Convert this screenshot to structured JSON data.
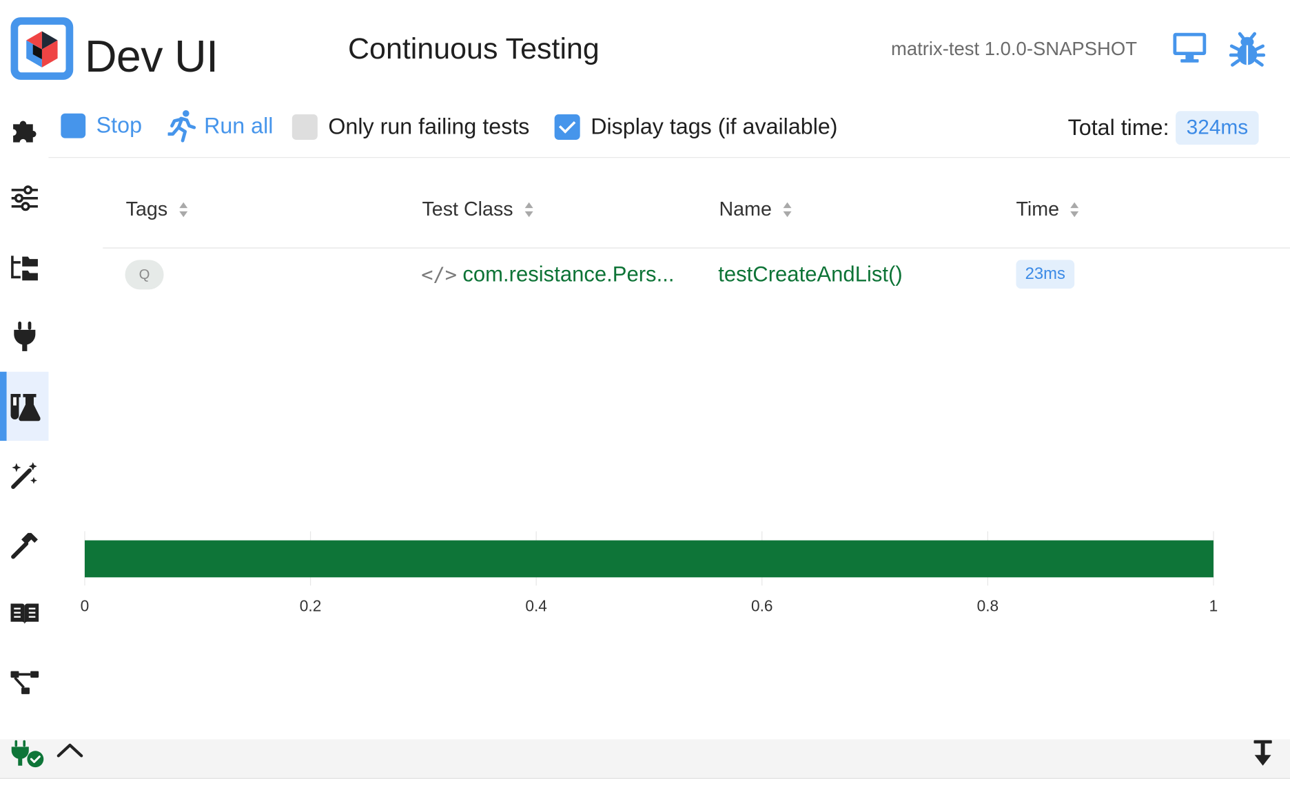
{
  "header": {
    "logo_text": "Dev UI",
    "page_title": "Continuous Testing",
    "app_version": "matrix-test 1.0.0-SNAPSHOT",
    "icons": [
      "monitor-icon",
      "bug-icon"
    ]
  },
  "sidebar": {
    "items": [
      {
        "icon": "puzzle-icon",
        "active": false
      },
      {
        "icon": "sliders-icon",
        "active": false
      },
      {
        "icon": "folder-tree-icon",
        "active": false
      },
      {
        "icon": "plug-icon",
        "active": false
      },
      {
        "icon": "flask-icon",
        "active": true
      },
      {
        "icon": "magic-wand-icon",
        "active": false
      },
      {
        "icon": "hammer-icon",
        "active": false
      },
      {
        "icon": "book-icon",
        "active": false
      },
      {
        "icon": "diagram-icon",
        "active": false
      }
    ]
  },
  "toolbar": {
    "stop_label": "Stop",
    "run_all_label": "Run all",
    "only_failing_label": "Only run failing tests",
    "only_failing_checked": false,
    "display_tags_label": "Display tags (if available)",
    "display_tags_checked": true,
    "total_time_label": "Total time:",
    "total_time_value": "324ms"
  },
  "table": {
    "columns": [
      "Tags",
      "Test Class",
      "Name",
      "Time"
    ],
    "rows": [
      {
        "tag": "Q",
        "test_class": "com.resistance.Pers...",
        "name": "testCreateAndList()",
        "time": "23ms"
      }
    ]
  },
  "chart_data": {
    "type": "bar",
    "orientation": "horizontal",
    "values": [
      1
    ],
    "xlim": [
      0,
      1
    ],
    "xticks": [
      "0",
      "0.2",
      "0.4",
      "0.6",
      "0.8",
      "1"
    ],
    "grid": true,
    "bar_color": "#0e7538"
  },
  "colors": {
    "accent": "#4695eb",
    "success": "#0e7538"
  }
}
